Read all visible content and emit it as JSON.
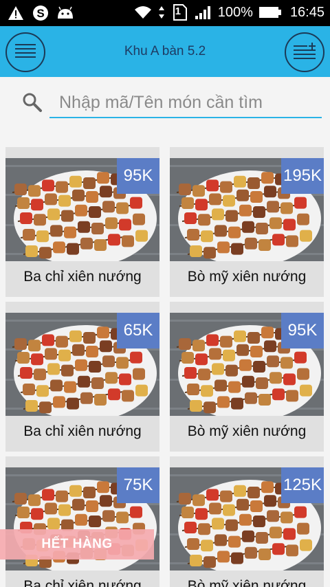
{
  "status_bar": {
    "battery_percent": "100%",
    "time": "16:45",
    "sim_label": "1",
    "icons": [
      "warning-icon",
      "skype-icon",
      "android-icon",
      "wifi-icon",
      "data-arrows-icon",
      "sim-icon",
      "signal-icon",
      "battery-icon"
    ]
  },
  "app_bar": {
    "title": "Khu A bàn 5.2",
    "left_button_icon": "menu-icon",
    "right_button_icon": "order-list-add-icon",
    "background_color": "#2ab3e6"
  },
  "search": {
    "placeholder": "Nhập mã/Tên món cần tìm",
    "value": ""
  },
  "menu_items": [
    {
      "name": "Ba chỉ xiên nướng",
      "price": "95K",
      "sold_out": false
    },
    {
      "name": "Bò mỹ xiên nướng",
      "price": "195K",
      "sold_out": false
    },
    {
      "name": "Ba chỉ xiên nướng",
      "price": "65K",
      "sold_out": false
    },
    {
      "name": "Bò mỹ xiên nướng",
      "price": "95K",
      "sold_out": false
    },
    {
      "name": "Ba chỉ xiên nướng",
      "price": "75K",
      "sold_out": true
    },
    {
      "name": "Bò mỹ xiên nướng",
      "price": "125K",
      "sold_out": false
    }
  ],
  "sold_out_label": "HẾT HÀNG",
  "colors": {
    "price_badge": "#5b7dc6",
    "card_background": "#e0e0e0",
    "sold_out_overlay": "#f5aaaf"
  }
}
